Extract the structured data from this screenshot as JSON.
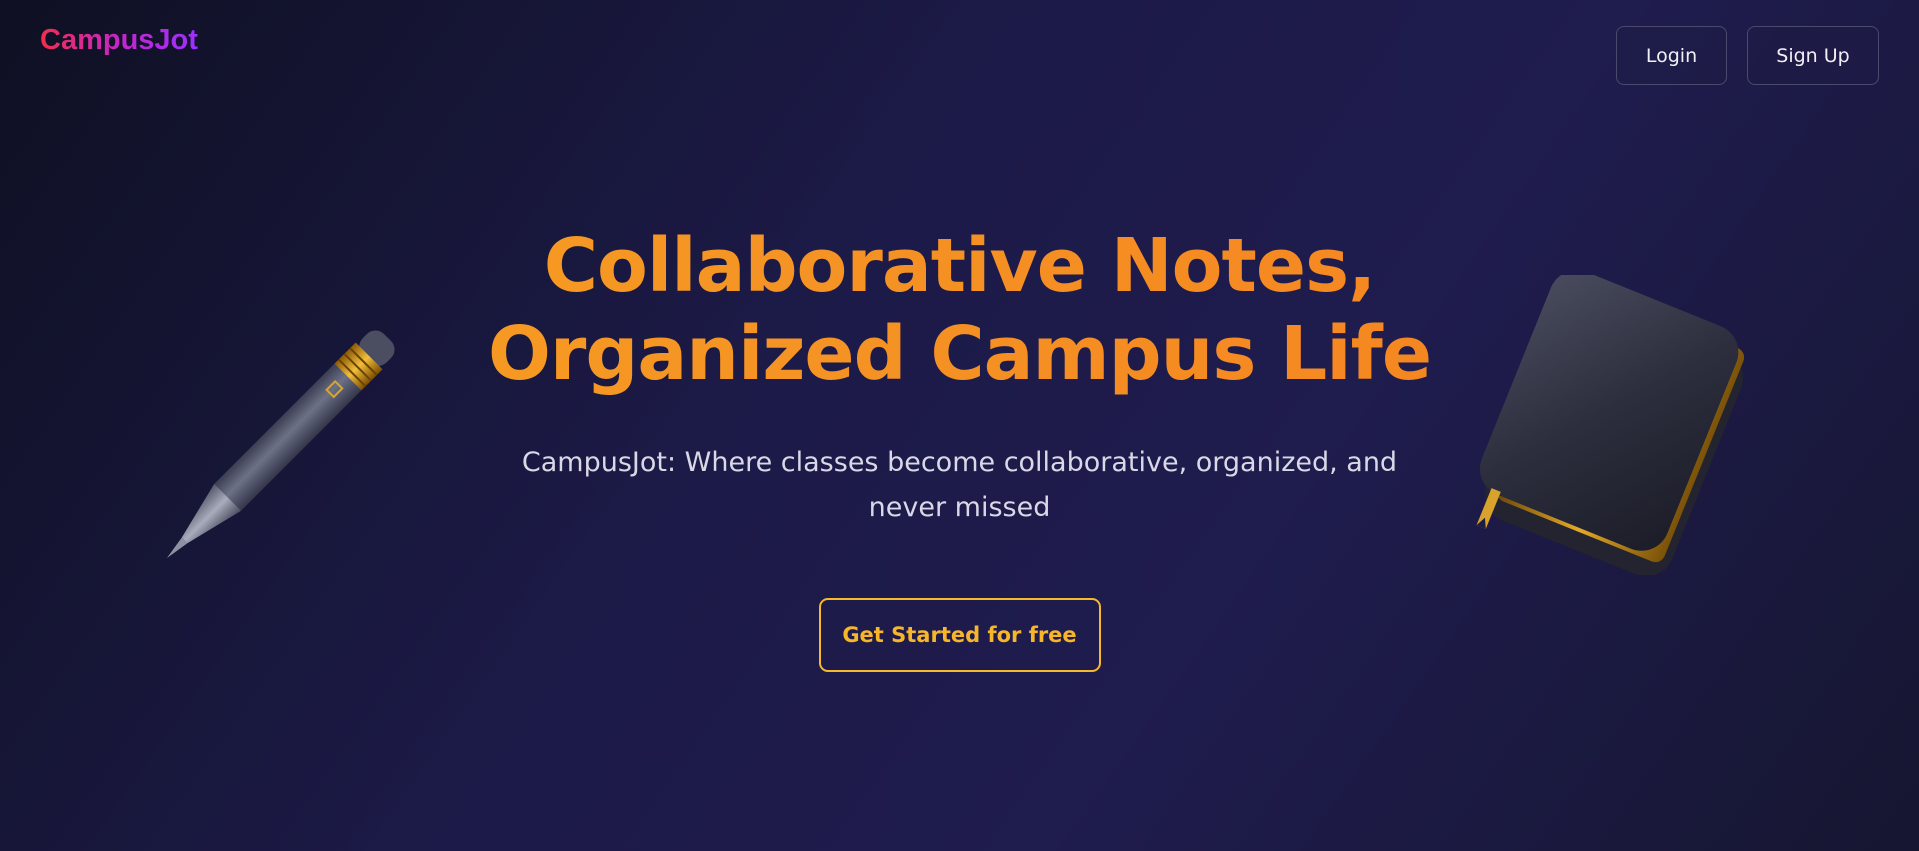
{
  "brand": {
    "logo_text": "CampusJot"
  },
  "nav": {
    "login_label": "Login",
    "signup_label": "Sign Up"
  },
  "hero": {
    "headline_line1": "Collaborative Notes,",
    "headline_line2": "Organized Campus Life",
    "subtitle": "CampusJot: Where classes become collaborative, organized, and never missed",
    "cta_label": "Get Started for free"
  },
  "illustrations": {
    "left": "pencil-icon",
    "right": "book-icon"
  },
  "colors": {
    "accent_orange": "#f59424",
    "cta_border": "#f5b92a",
    "logo_gradient_start": "#f02e4e",
    "logo_gradient_end": "#9b30ff",
    "background": "#1c1a47"
  }
}
